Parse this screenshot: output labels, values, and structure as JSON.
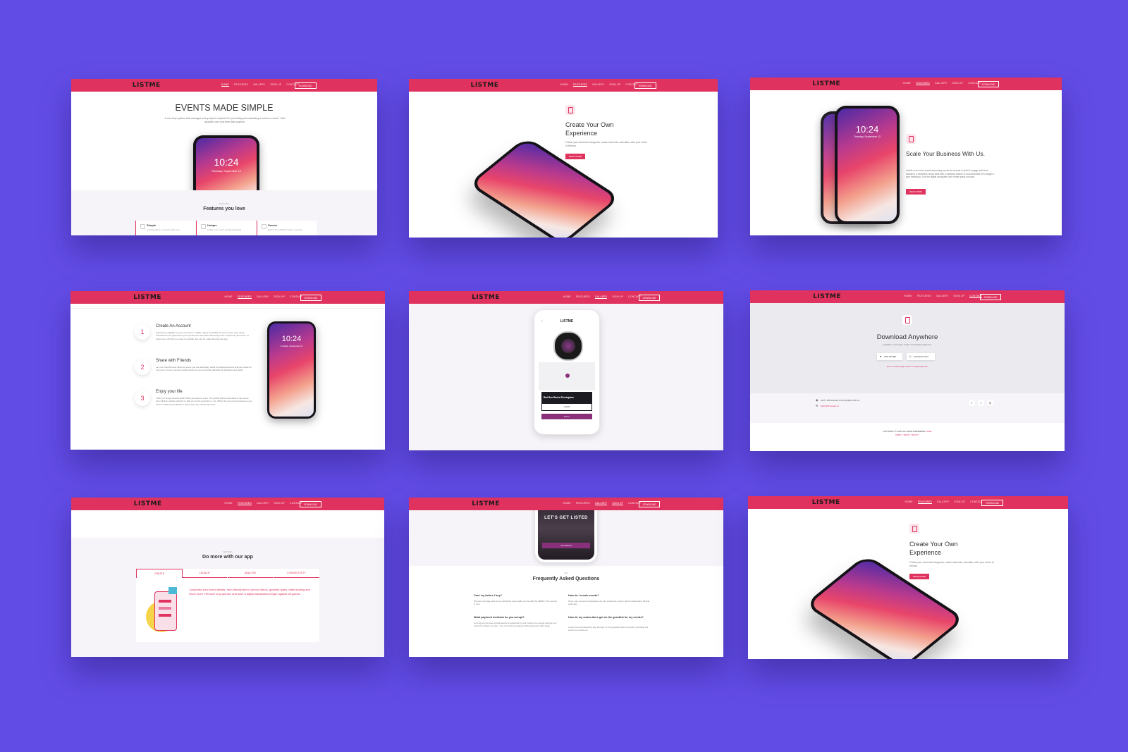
{
  "nav": {
    "logo": "LISTME",
    "links": [
      "HOME",
      "FEATURES",
      "GALLERY",
      "SIGN UP",
      "CONTACT"
    ],
    "download": "DOWNLOAD"
  },
  "phone": {
    "time": "10:24",
    "date": "Tuesday, September 12"
  },
  "s1": {
    "title": "EVENTS MADE SIMPLE",
    "desc": "A one-stop system that manages every aspect required for promoting and marketing a venue or event. Club analytics and real-time data capture.",
    "features_kicker": "FEATURES",
    "features_title": "Features you love",
    "cards": [
      {
        "title": "Simple",
        "desc": "A simple place to connect with your"
      },
      {
        "title": "Unique",
        "desc": "ListMe is an event social networking"
      },
      {
        "title": "Secure",
        "desc": "Built in ID verification and a one stop"
      }
    ]
  },
  "s2": {
    "title": "Create Your Own Experience",
    "desc": "Follow your favourite hangouts, share interests, activities, with your circle of friends.",
    "button": "READ MORE"
  },
  "s3": {
    "title": "Scale Your Business With Us.",
    "desc": "ListMe is an event social networking service for brands to build & engage with their followers, a seamless virtual desk with a cashless feature to accommodate the change in user behaviour. Join the digital ecosystem and create guess success.",
    "button": "READ MORE"
  },
  "s4": {
    "steps": [
      {
        "num": "1",
        "title": "Create An Account",
        "desc": "Experience nightlife on your own terms. ListMe makes it possible for you to have your name submitted to the guest list of your preference club while still being in the comfort of your home, or hotel room. All that you need is a profile that can be made through the app."
      },
      {
        "num": "2",
        "title": "Share with Friends",
        "desc": "Let your friends know what hot event you are attending; avoid the disappointment and get ticked for the event. To put it simply, ListMe works as your personal nightclub list assistant and guide."
      },
      {
        "num": "3",
        "title": "Enjoy your life",
        "desc": "Then you simply decide which clubs you want to enter. The profile will be submitted to the venue who will then decide whether to add you to the guest list or not. When the venue has answered, you will be notified immediately. It doesn't get any easier than that."
      }
    ]
  },
  "s5": {
    "logo": "LISTME",
    "venue": "Bad Boo Banks Birmingham",
    "list": "ListMe",
    "btn": "Event"
  },
  "s6": {
    "title": "Download Anywhere",
    "sub": "Available for all major mobile and desktop platforms.",
    "app_store": "APP STORE",
    "google_play": "GOOGLE PLAY",
    "note": "Terms of ListMe apply. Listed on Google Play store.",
    "address": "2215, 101 Newhall St Birmingham B3 1LL",
    "email": "hello@listmeapp.co",
    "copyright": "COPYRIGHT © 2018. ALL RIGHTS RESERVED",
    "brand": "ListMe",
    "legal": "PRESS · TERMS · PRIVACY"
  },
  "s7": {
    "kicker": "FEATURES",
    "title": "Do more with our app",
    "tabs": [
      "CREATE",
      "LAUNCH",
      "ANALYSE",
      "CONNECTIVITY"
    ],
    "body": "Customise your event details, from description to promo videos, guestlist types, table seating and much more. Remove long queues and have a digital transaction ledger against all guests."
  },
  "s8": {
    "banner": "LET'S GET LISTED",
    "cta": "Get Started",
    "kicker": "FAQ",
    "title": "Frequently Asked Questions",
    "faqs": [
      {
        "q": "Can I try before I buy?",
        "a": "We sign up today and let our activation team walk you through the DEMO. The service is free."
      },
      {
        "q": "How do I create events?",
        "a": "Once your account is activated you can create the events via the dashboard. Simple and easy."
      },
      {
        "q": "What payment methods do you accept?",
        "a": "As long as you have a bank account registered in your country we accept and get you up and running in no time. You can start accepting mobile payments right away."
      },
      {
        "q": "How do my subscribers get on the guestlist for my events?",
        "a": "A user can download the app and get on the guestlist within seconds, providing the event is not sold out."
      }
    ]
  },
  "s9": {
    "title": "Create Your Own Experience",
    "desc": "Follow your favourite hangouts, share interests, activities, with your circle of friends.",
    "button": "READ MORE"
  }
}
